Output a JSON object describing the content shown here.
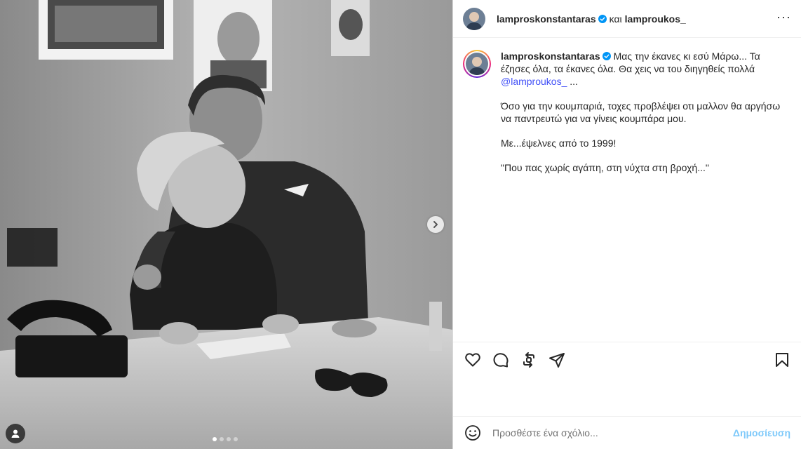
{
  "header": {
    "author": "lamproskonstantaras",
    "and_word": "και",
    "coauthor": "lamproukos_",
    "more_label": "···"
  },
  "caption": {
    "username": "lamproskonstantaras",
    "paragraph1": "Μας την έκανες κι εσύ Μάρω... Τα έζησες όλα, τα έκανες όλα. Θα χεις να του διηγηθείς πολλά",
    "mention": "@lamproukos_",
    "paragraph1_end": " ...",
    "paragraph2": "Όσο για την κουμπαριά, τοχες προβλέψει οτι μαλλον θα αργήσω να παντρευτώ για να γίνεις κουμπάρα μου.",
    "paragraph3": "Με...έψελνες από το 1999!",
    "paragraph4": "\"Που πας χωρίς αγάπη, στη νύχτα στη βροχή...\""
  },
  "actions": {
    "icons": [
      "heart-icon",
      "comment-icon",
      "repost-icon",
      "share-icon",
      "bookmark-icon"
    ]
  },
  "comment": {
    "placeholder": "Προσθέστε ένα σχόλιο...",
    "post_label": "Δημοσίευση"
  },
  "media": {
    "carousel_count": 4,
    "active_index": 0,
    "description_color": "#6e6e6e"
  },
  "colors": {
    "verified": "#0095f6",
    "link": "#4150f7",
    "post_button": "#0095f6"
  }
}
